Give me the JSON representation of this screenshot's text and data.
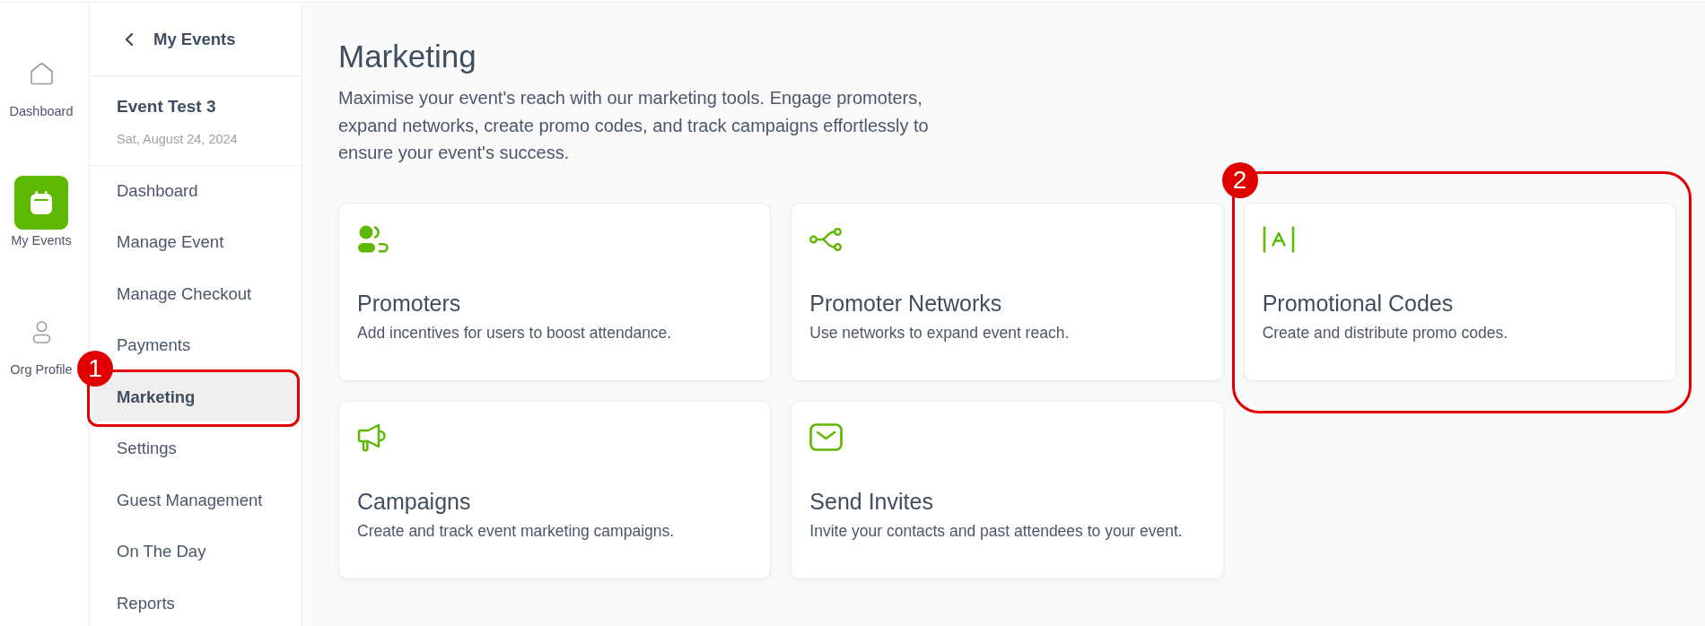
{
  "rail": {
    "items": [
      {
        "label": "Dashboard",
        "selected": false
      },
      {
        "label": "My Events",
        "selected": true
      },
      {
        "label": "Org Profile",
        "selected": false
      }
    ]
  },
  "sidebar": {
    "back_link": "My Events",
    "event": {
      "title": "Event Test 3",
      "date": "Sat, August 24, 2024"
    },
    "items": [
      {
        "label": "Dashboard",
        "selected": false
      },
      {
        "label": "Manage Event",
        "selected": false
      },
      {
        "label": "Manage Checkout",
        "selected": false
      },
      {
        "label": "Payments",
        "selected": false
      },
      {
        "label": "Marketing",
        "selected": true,
        "callout": "1"
      },
      {
        "label": "Settings",
        "selected": false
      },
      {
        "label": "Guest Management",
        "selected": false
      },
      {
        "label": "On The Day",
        "selected": false
      },
      {
        "label": "Reports",
        "selected": false
      }
    ]
  },
  "page": {
    "title": "Marketing",
    "description": "Maximise your event's reach with our marketing tools. Engage promoters, expand networks, create promo codes, and track campaigns effortlessly to ensure your event's success."
  },
  "cards": [
    {
      "title": "Promoters",
      "description": "Add incentives for users to boost attendance."
    },
    {
      "title": "Promoter Networks",
      "description": "Use networks to expand event reach."
    },
    {
      "title": "Promotional Codes",
      "description": "Create and distribute promo codes.",
      "callout": "2"
    },
    {
      "title": "Campaigns",
      "description": "Create and track event marketing campaigns."
    },
    {
      "title": "Send Invites",
      "description": "Invite your contacts and past attendees to your event."
    }
  ]
}
